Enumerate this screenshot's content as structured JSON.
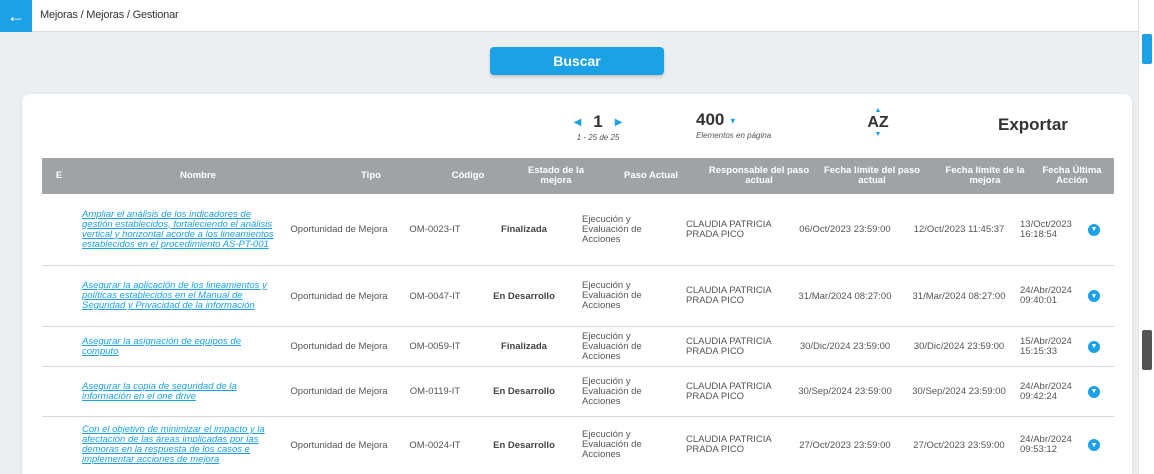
{
  "header": {
    "breadcrumb": "Mejoras / Mejoras / Gestionar",
    "back_icon": "arrow-left-icon"
  },
  "search": {
    "button_label": "Buscar"
  },
  "pagination": {
    "page": "1",
    "range": "1 - 25 de 25",
    "per_page": "400",
    "per_page_label": "Elementos en página"
  },
  "toolbar": {
    "sort_label": "AZ",
    "export_label": "Exportar"
  },
  "table": {
    "headers": [
      "E",
      "Nombre",
      "Tipo",
      "Código",
      "Estado de la mejora",
      "Paso Actual",
      "Responsable del paso actual",
      "Fecha límite del paso actual",
      "Fecha límite de la mejora",
      "Fecha Última Acción"
    ],
    "rows": [
      {
        "nombre": "Ampliar el análisis de los indicadores de gestión establecidos, fortaleciendo el análisis vertical y horizontal acorde a los lineamientos establecidos en el procedimiento AS-PT-001",
        "tipo": "Oportunidad de Mejora",
        "codigo": "OM-0023-IT",
        "estado": "Finalizada",
        "paso": "Ejecución y Evaluación de Acciones",
        "responsable": "CLAUDIA PATRICIA PRADA PICO",
        "fecha_limite_paso": "06/Oct/2023 23:59:00",
        "fecha_limite_mejora": "12/Oct/2023 11:45:37",
        "fecha_ultima": "13/Oct/2023 16:18:54"
      },
      {
        "nombre": "Asegurar la aplicación de los lineamientos y políticas establecidos en el Manual de Seguridad y Privacidad de la información",
        "tipo": "Oportunidad de Mejora",
        "codigo": "OM-0047-IT",
        "estado": "En Desarrollo",
        "paso": "Ejecución y Evaluación de Acciones",
        "responsable": "CLAUDIA PATRICIA PRADA PICO",
        "fecha_limite_paso": "31/Mar/2024 08:27:00",
        "fecha_limite_mejora": "31/Mar/2024 08:27:00",
        "fecha_ultima": "24/Abr/2024 09:40:01"
      },
      {
        "nombre": "Asegurar la asignación de equipos de computo",
        "tipo": "Oportunidad de Mejora",
        "codigo": "OM-0059-IT",
        "estado": "Finalizada",
        "paso": "Ejecución y Evaluación de Acciones",
        "responsable": "CLAUDIA PATRICIA PRADA PICO",
        "fecha_limite_paso": "30/Dic/2024 23:59:00",
        "fecha_limite_mejora": "30/Dic/2024 23:59:00",
        "fecha_ultima": "15/Abr/2024 15:15:33"
      },
      {
        "nombre": "Asegurar la copia de seguridad de la información en el one drive",
        "tipo": "Oportunidad de Mejora",
        "codigo": "OM-0119-IT",
        "estado": "En Desarrollo",
        "paso": "Ejecución y Evaluación de Acciones",
        "responsable": "CLAUDIA PATRICIA PRADA PICO",
        "fecha_limite_paso": "30/Sep/2024 23:59:00",
        "fecha_limite_mejora": "30/Sep/2024 23:59:00",
        "fecha_ultima": "24/Abr/2024 09:42:24"
      },
      {
        "nombre": "Con el objetivo de minimizar el impacto y la afectación de las áreas implicadas por las demoras en la respuesta de los casos e implementar acciones de mejora",
        "tipo": "Oportunidad de Mejora",
        "codigo": "OM-0024-IT",
        "estado": "En Desarrollo",
        "paso": "Ejecución y Evaluación de Acciones",
        "responsable": "CLAUDIA PATRICIA PRADA PICO",
        "fecha_limite_paso": "27/Oct/2023 23:59:00",
        "fecha_limite_mejora": "27/Oct/2023 23:59:00",
        "fecha_ultima": "24/Abr/2024 09:53:12"
      }
    ]
  }
}
